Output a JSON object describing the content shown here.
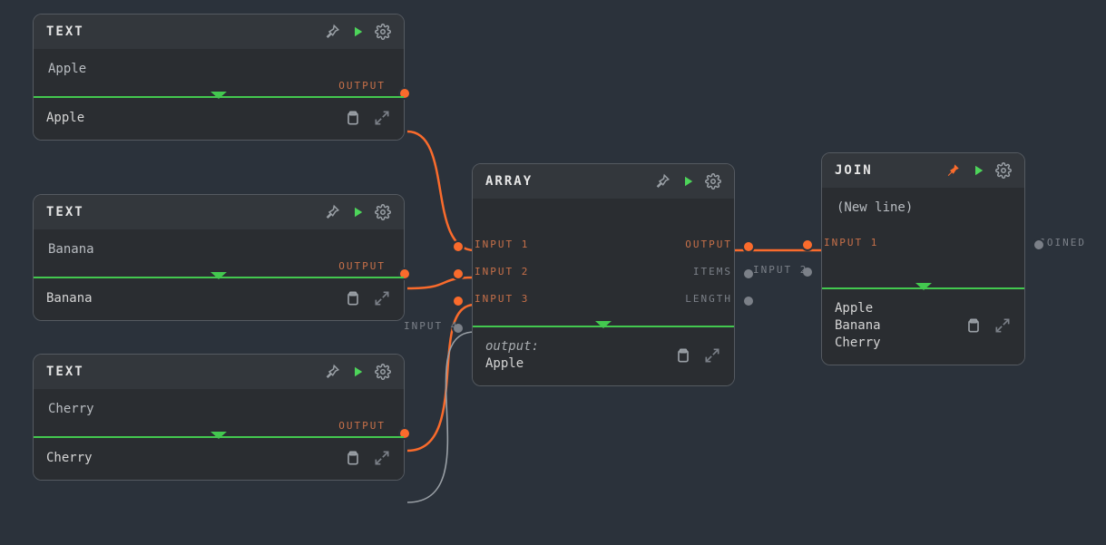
{
  "colors": {
    "accent": "#fa6b2c",
    "run": "#4dd45a",
    "green_bar": "#43c84f",
    "bg": "#2b323b"
  },
  "ports": {
    "labels": {
      "output": "OUTPUT"
    }
  },
  "nodes": {
    "text1": {
      "title": "TEXT",
      "value": "Apple",
      "output": "Apple",
      "pinned": false
    },
    "text2": {
      "title": "TEXT",
      "value": "Banana",
      "output": "Banana",
      "pinned": false
    },
    "text3": {
      "title": "TEXT",
      "value": "Cherry",
      "output": "Cherry",
      "pinned": false
    },
    "array": {
      "title": "ARRAY",
      "pinned": false,
      "inputs": {
        "in1": "INPUT 1",
        "in2": "INPUT 2",
        "in3": "INPUT 3",
        "in4": "INPUT 4"
      },
      "outputs": {
        "output": "OUTPUT",
        "items": "ITEMS",
        "length": "LENGTH"
      },
      "result_label": "output:",
      "result_value": "Apple"
    },
    "join": {
      "title": "JOIN",
      "pinned": true,
      "body": "(New line)",
      "inputs": {
        "in1": "INPUT 1",
        "in2": "INPUT 2"
      },
      "outputs": {
        "joined": "JOINED"
      },
      "result": "Apple\nBanana\nCherry"
    }
  },
  "connections": [
    {
      "from": "text1.output",
      "to": "array.in1",
      "state": "active"
    },
    {
      "from": "text2.output",
      "to": "array.in2",
      "state": "active"
    },
    {
      "from": "text3.output",
      "to": "array.in3",
      "state": "active"
    },
    {
      "from": null,
      "to": "array.in4",
      "state": "idle_dangling"
    },
    {
      "from": "array.output",
      "to": "join.in1",
      "state": "active"
    }
  ]
}
